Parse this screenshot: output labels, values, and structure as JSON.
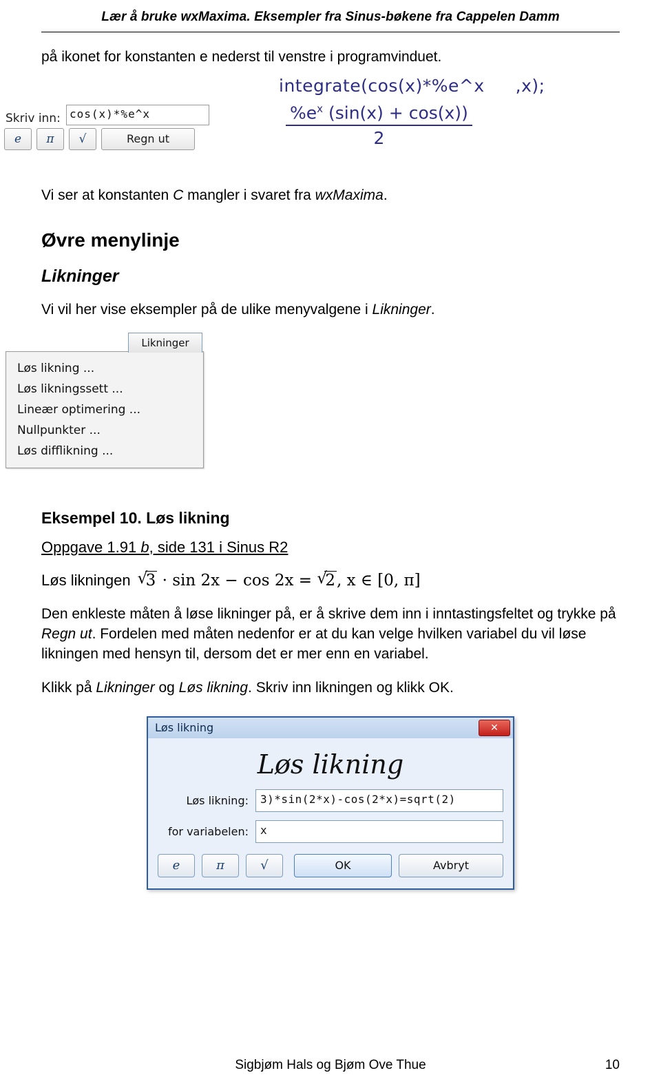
{
  "header": {
    "title": "Lær å bruke wxMaxima. Eksempler fra Sinus-bøkene fra Cappelen Damm"
  },
  "intro": {
    "line1": "på ikonet for konstanten e nederst til venstre i programvinduet.",
    "line2_pre": "Vi ser at konstanten ",
    "line2_c": "C",
    "line2_mid": " mangler i svaret fra ",
    "line2_wx": "wxMaxima",
    "line2_post": "."
  },
  "figure_input": {
    "skriv_inn_label": "Skriv inn:",
    "input_value": "cos(x)*%e^x",
    "btn_e": "e",
    "btn_pi": "π",
    "btn_sqrt": "√",
    "btn_regn_ut": "Regn ut",
    "maxima_command": "integrate(cos(x)*%e^x",
    "maxima_command_tail": ",x);",
    "result_numerator_pre": "%e",
    "result_numerator_sup": "x",
    "result_numerator_post": "(sin(x) + cos(x))",
    "result_denominator": "2"
  },
  "sections": {
    "ovre_menylinje": "Øvre menylinje",
    "likninger": "Likninger",
    "likninger_intro_pre": "Vi vil her vise eksempler på de ulike menyvalgene i ",
    "likninger_intro_it": "Likninger",
    "likninger_intro_post": ".",
    "eksempel_10": "Eksempel 10. Løs likning",
    "oppgave_pre": "Oppgave 1.91 ",
    "oppgave_it": "b",
    "oppgave_post": ", side 131 i Sinus R2"
  },
  "menu_figure": {
    "tab_label": "Likninger",
    "items": [
      "Løs likning ...",
      "Løs likningssett ...",
      "Lineær optimering ...",
      "Nullpunkter ...",
      "Løs difflikning ..."
    ]
  },
  "equation": {
    "prefix": "Løs likningen",
    "sqrt3": "3",
    "term1": "· sin 2x − cos 2x =",
    "sqrt2": "2",
    "domain": ", x ∈ [0, π]"
  },
  "paragraphs": {
    "p1_pre": "Den enkleste måten å løse likninger på, er å skrive dem inn i inntastingsfeltet og trykke på ",
    "p1_it": "Regn ut",
    "p1_post": ". Fordelen med måten nedenfor er at du kan velge hvilken variabel du vil løse likningen med hensyn til, dersom det er mer enn en variabel.",
    "p2_pre": "Klikk på ",
    "p2_it1": "Likninger",
    "p2_mid": " og ",
    "p2_it2": "Løs likning",
    "p2_post": ". Skriv inn likningen og klikk OK."
  },
  "dialog": {
    "titlebar": "Løs likning",
    "close_label": "✕",
    "heading": "Løs likning",
    "label_likning": "Løs likning:",
    "value_likning": "3)*sin(2*x)-cos(2*x)=sqrt(2)",
    "label_variabel": "for variabelen:",
    "value_variabel": "x",
    "btn_e": "e",
    "btn_pi": "π",
    "btn_sqrt": "√",
    "btn_ok": "OK",
    "btn_avbryt": "Avbryt"
  },
  "footer": {
    "authors": "Sigbjøm Hals og Bjøm Ove Thue",
    "page_number": "10"
  }
}
